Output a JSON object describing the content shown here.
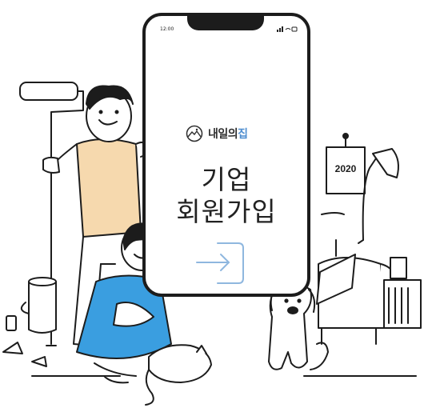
{
  "status_bar": {
    "time": "12:00"
  },
  "brand": {
    "part1": "내일의",
    "part2": "집"
  },
  "title": {
    "line1": "기업",
    "line2": "회원가입"
  },
  "calendar": {
    "year": "2020"
  },
  "colors": {
    "accent": "#4f8ed0",
    "dress": "#3a9ee0",
    "shirt": "#f6d9ae",
    "ink": "#1c1c1c"
  },
  "icons": {
    "signup_action": "sign-in-arrow-icon",
    "logo": "house-mountain-logo-icon"
  }
}
